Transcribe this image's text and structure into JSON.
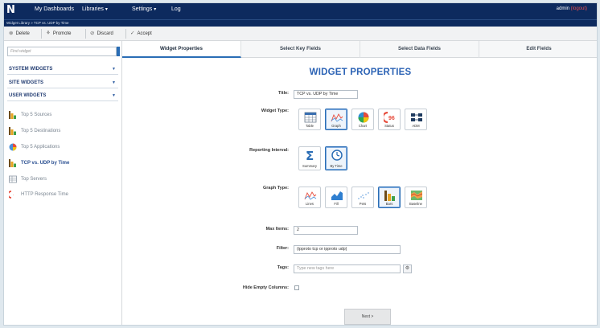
{
  "nav": {
    "items": [
      {
        "label": "My Dashboards",
        "caret": ""
      },
      {
        "label": "Libraries",
        "caret": "▾"
      },
      {
        "label": "Settings",
        "caret": "▾"
      },
      {
        "label": "Log",
        "caret": ""
      }
    ],
    "admin_user": "admin",
    "admin_action": "(logout)",
    "breadcrumb": "Widget Library » TCP vs. UDP by Time",
    "logo_letter": "N"
  },
  "toolbar": {
    "delete": "Delete",
    "promote": "Promote",
    "discard": "Discard",
    "accept": "Accept"
  },
  "sidebar": {
    "search_placeholder": "Find widget",
    "sections": [
      {
        "label": "SYSTEM WIDGETS"
      },
      {
        "label": "SITE WIDGETS"
      },
      {
        "label": "USER WIDGETS"
      }
    ],
    "items": [
      {
        "label": "Top 5 Sources",
        "icon": "bar-chart-icon",
        "active": false
      },
      {
        "label": "Top 5 Destinations",
        "icon": "bar-chart-icon",
        "active": false
      },
      {
        "label": "Top 5 Applications",
        "icon": "pie-chart-icon",
        "active": false
      },
      {
        "label": "TCP vs. UDP by Time",
        "icon": "bar-chart-icon",
        "active": true
      },
      {
        "label": "Top Servers",
        "icon": "table-icon",
        "active": false
      },
      {
        "label": "HTTP Response Time",
        "icon": "status-icon",
        "active": false
      }
    ]
  },
  "tabs": [
    {
      "label": "Widget Properties",
      "active": true
    },
    {
      "label": "Select Key Fields",
      "active": false
    },
    {
      "label": "Select Data Fields",
      "active": false
    },
    {
      "label": "Edit Fields",
      "active": false
    }
  ],
  "form": {
    "heading": "WIDGET PROPERTIES",
    "title_label": "Title:",
    "title_value": "TCP vs. UDP by Time",
    "widget_type_label": "Widget Type:",
    "widget_types": [
      {
        "label": "Table",
        "selected": false
      },
      {
        "label": "Graph",
        "selected": true
      },
      {
        "label": "Chart",
        "selected": false
      },
      {
        "label": "Status",
        "selected": false
      },
      {
        "label": "ADM",
        "selected": false
      }
    ],
    "status_number": "96",
    "reporting_label": "Reporting Interval:",
    "reporting_types": [
      {
        "label": "Summary",
        "selected": false
      },
      {
        "label": "By Time",
        "selected": true
      }
    ],
    "graph_type_label": "Graph Type:",
    "graph_types": [
      {
        "label": "Lines",
        "selected": false
      },
      {
        "label": "Fill",
        "selected": false
      },
      {
        "label": "Pets",
        "selected": false
      },
      {
        "label": "Bars",
        "selected": true
      },
      {
        "label": "Baseline",
        "selected": false
      }
    ],
    "max_items_label": "Max Items:",
    "max_items_value": "2",
    "filter_label": "Filter:",
    "filter_value": "(ipproto tcp or ipproto udp)",
    "tags_label": "Tags:",
    "tags_placeholder": "Type new tags here",
    "hide_empty_label": "Hide Empty Columns:",
    "next_label": "Next >"
  },
  "colors": {
    "nav": "#0d2a5e",
    "accent": "#2c63b5",
    "selected_border": "#2a6db5"
  }
}
